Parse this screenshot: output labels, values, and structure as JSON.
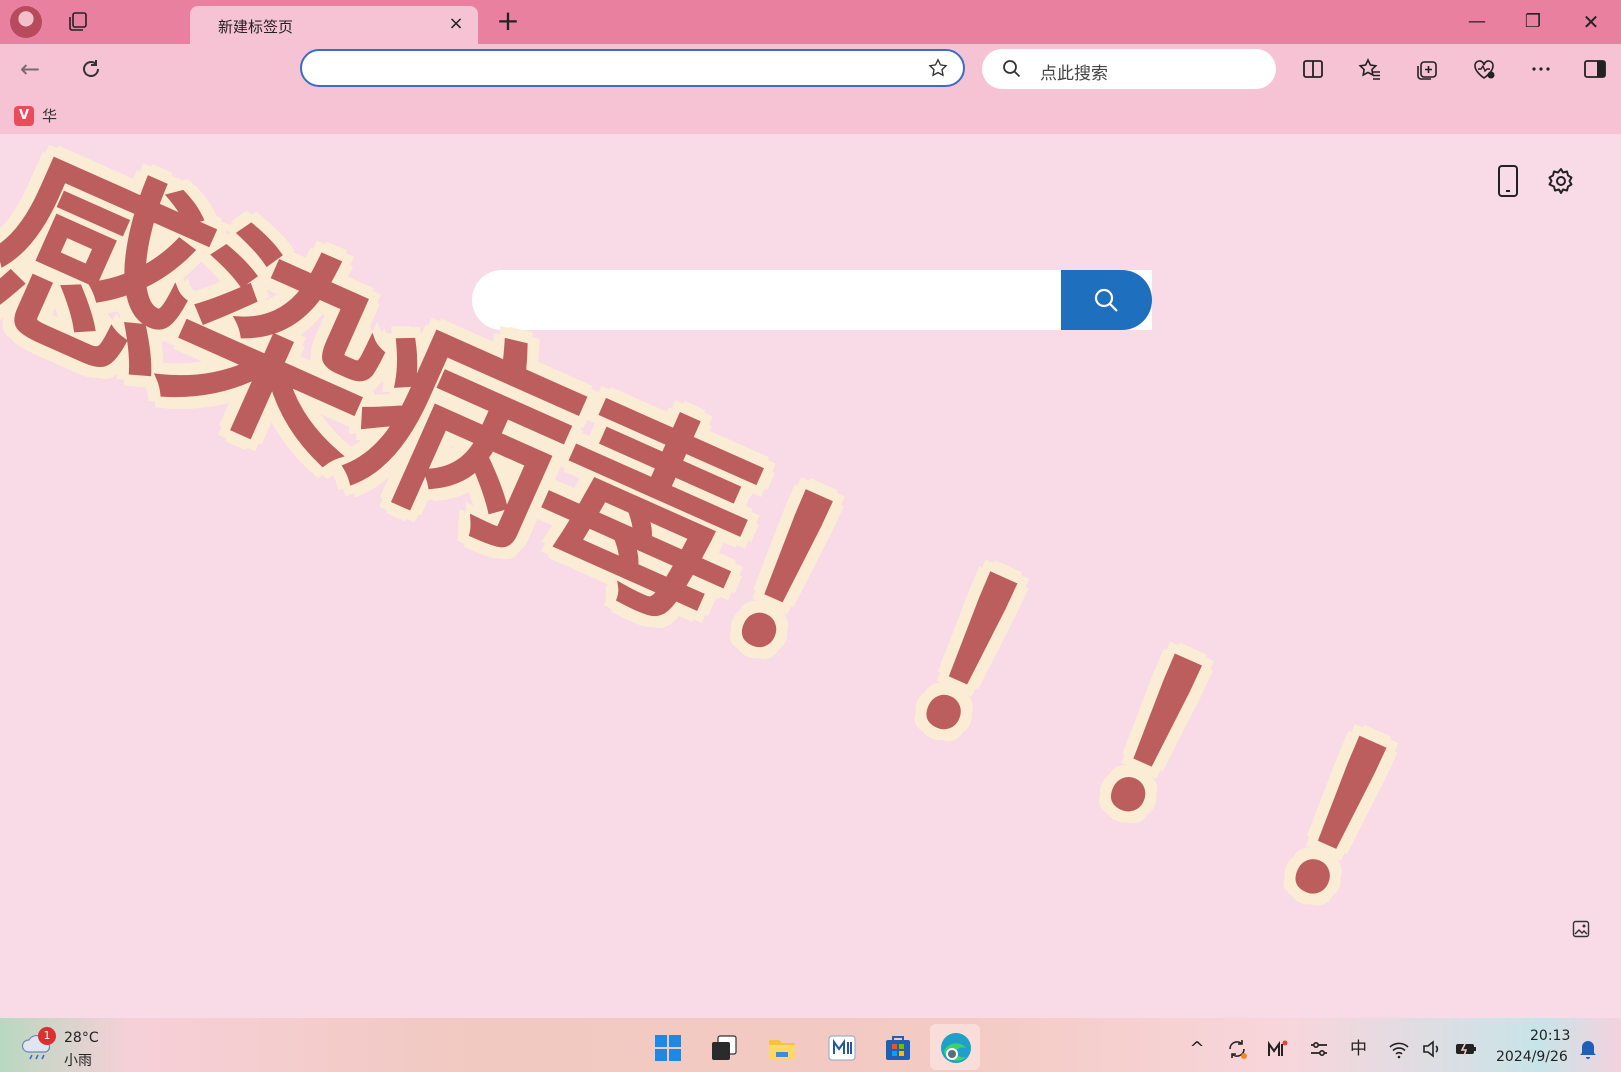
{
  "browser": {
    "tab": {
      "title": "新建标签页",
      "close_glyph": "×"
    },
    "new_tab_glyph": "+",
    "window_controls": {
      "minimize": "—",
      "maximize": "❐",
      "close": "✕"
    },
    "back_glyph": "←",
    "search_box": {
      "placeholder": "点此搜索"
    },
    "bookmark": {
      "icon_letter": "V",
      "label": "华"
    }
  },
  "overlay": {
    "text": "感染病毒！！！！"
  },
  "taskbar": {
    "weather": {
      "badge": "1",
      "temperature": "28°C",
      "condition": "小雨"
    },
    "tray": {
      "chevron": "^",
      "ime": "中"
    },
    "clock": {
      "time": "20:13",
      "date": "2024/9/26"
    }
  },
  "colors": {
    "titlebar": "#e9809f",
    "toolbar": "#f6c3d4",
    "page_bg": "#f8dbe6",
    "search_button": "#1f6fbf",
    "overlay_text": "#bd5e5e",
    "overlay_outline": "#fbecd6"
  }
}
